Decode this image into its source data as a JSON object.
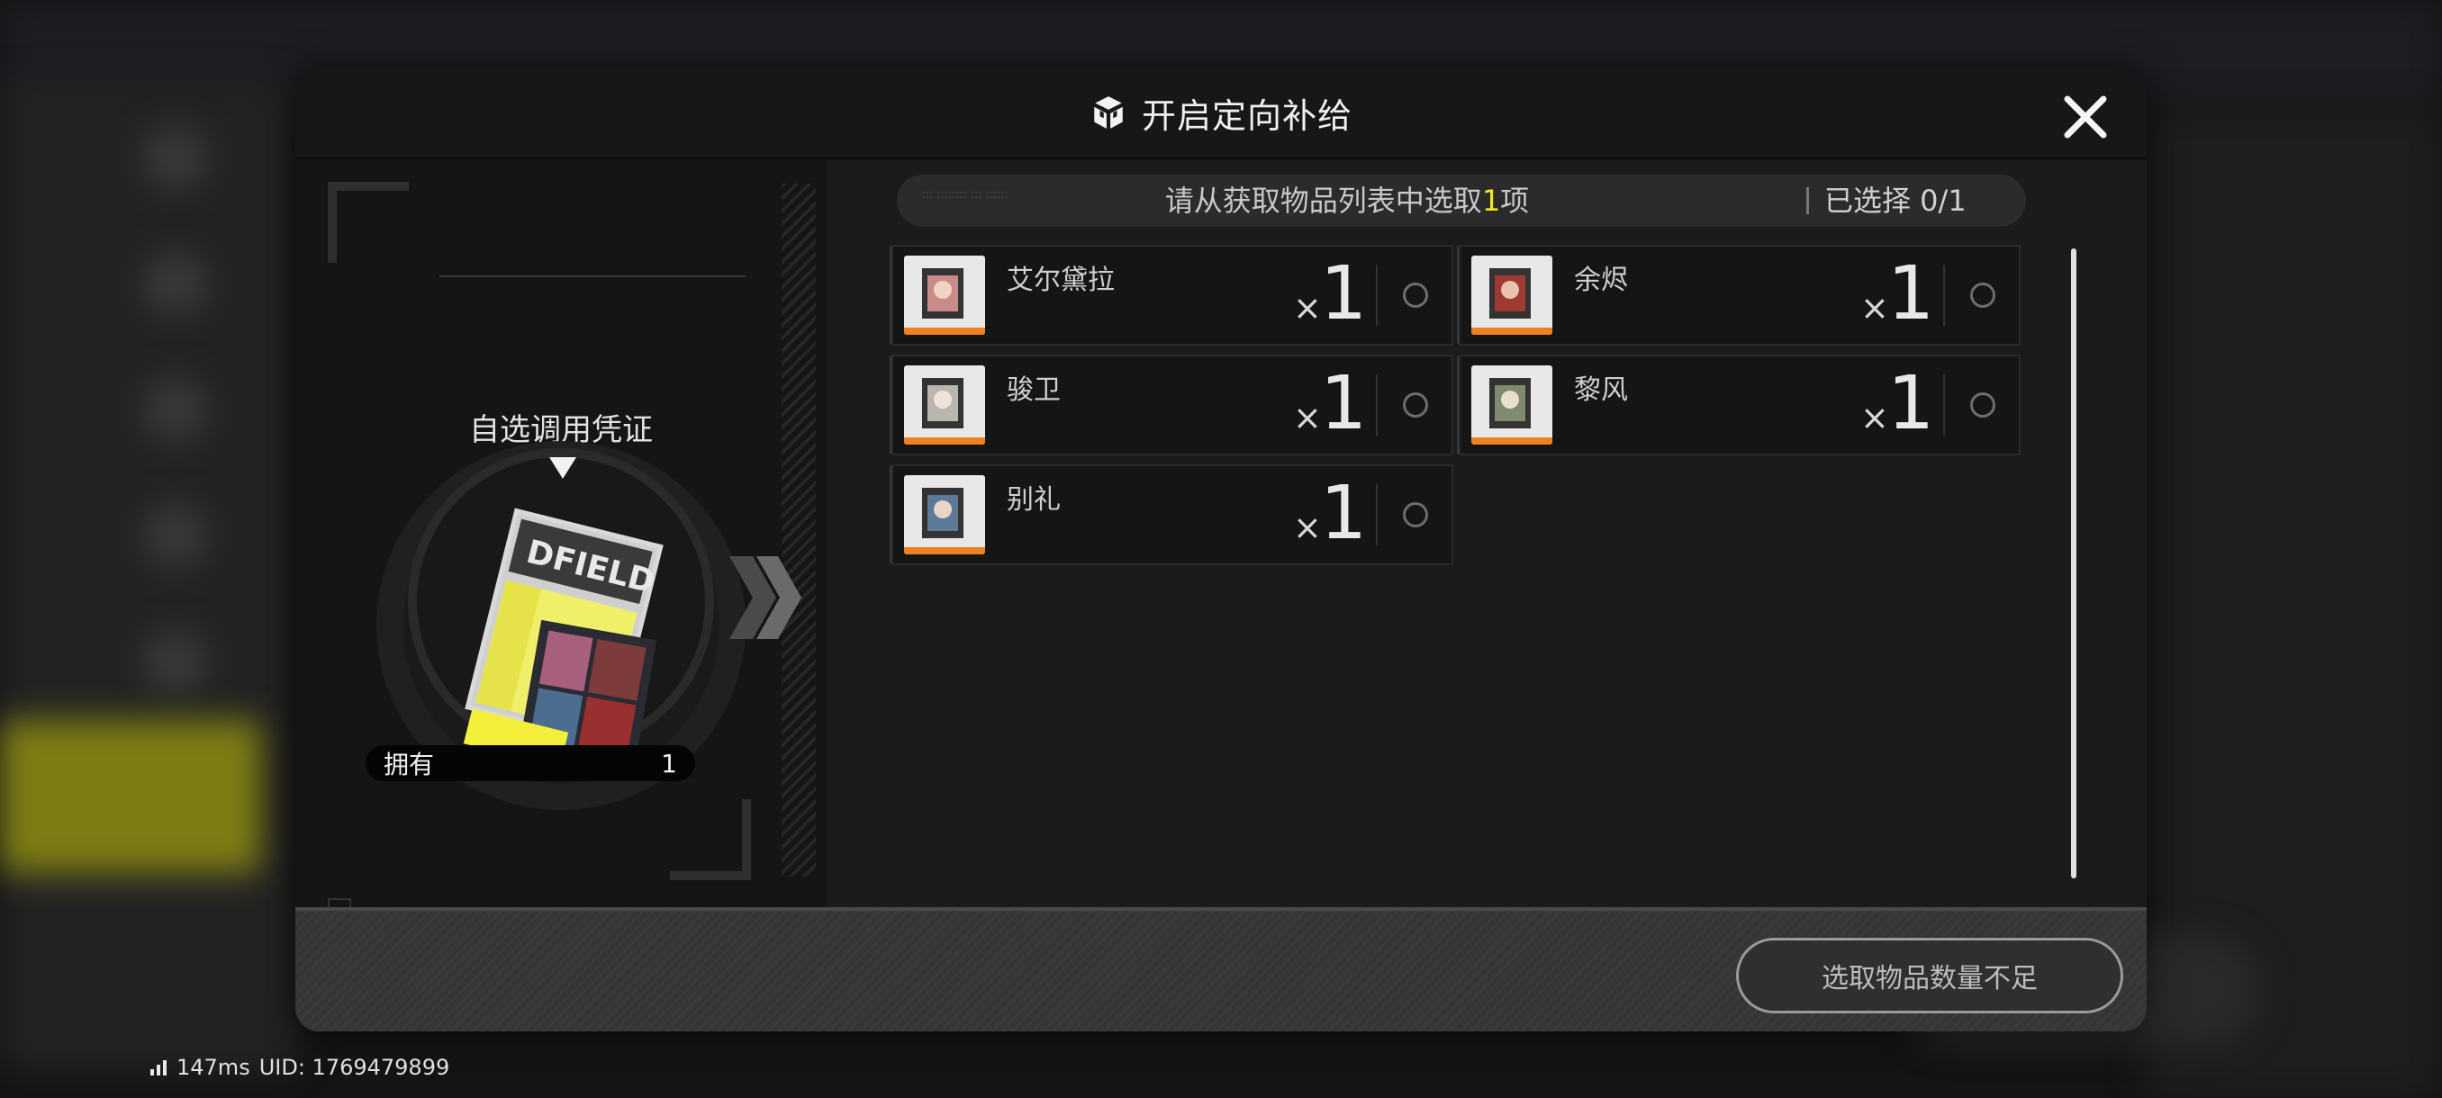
{
  "dialog": {
    "title": "开启定向补给",
    "title_icon": "box-icon",
    "close_icon": "close-icon"
  },
  "voucher": {
    "label": "自选调用凭证",
    "own_label": "拥有",
    "own_count": "1"
  },
  "selection": {
    "prompt_before": "请从获取物品列表中选取",
    "prompt_num": "1",
    "prompt_after": "项",
    "selected_text": "已选择 0/1",
    "highlight_color": "#f5e61c"
  },
  "items": [
    {
      "name": "艾尔黛拉",
      "x": "×",
      "qty": "1"
    },
    {
      "name": "余烬",
      "x": "×",
      "qty": "1"
    },
    {
      "name": "骏卫",
      "x": "×",
      "qty": "1"
    },
    {
      "name": "黎风",
      "x": "×",
      "qty": "1"
    },
    {
      "name": "别礼",
      "x": "×",
      "qty": "1"
    }
  ],
  "footer": {
    "confirm_label": "选取物品数量不足"
  },
  "status": {
    "ping": "147ms",
    "uid": "UID: 1769479899"
  }
}
